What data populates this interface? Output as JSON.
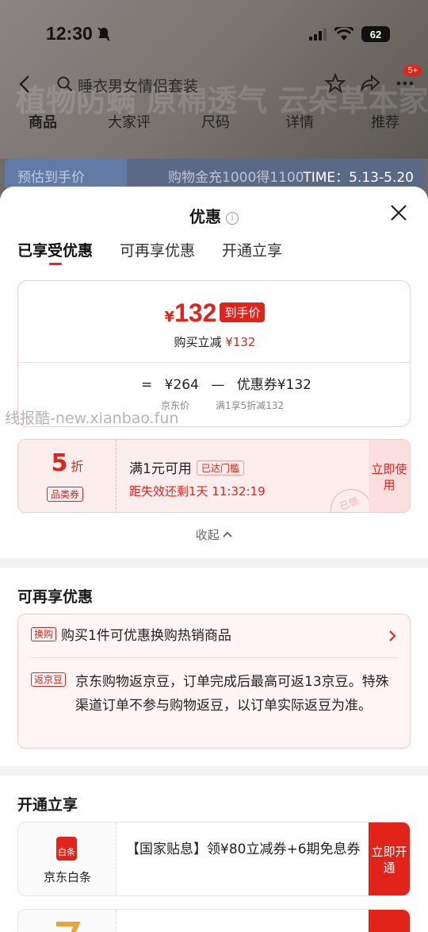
{
  "status": {
    "time": "12:30",
    "battery": "62"
  },
  "nav": {
    "search_text": "睡衣男女情侣套装",
    "cart_badge": "5+"
  },
  "bg_tabs": [
    "商品",
    "大家评",
    "尺码",
    "详情",
    "推荐"
  ],
  "bg_promo": {
    "left": "预估到手价",
    "middle": "购物金充1000得1100",
    "time": "TIME：5.13-5.20"
  },
  "bg_banner_text": "植物防螨 原棉透气 云朵草本家居服",
  "sheet": {
    "title": "优惠",
    "tabs": [
      "已享受优惠",
      "可再享优惠",
      "开通立享"
    ],
    "price": {
      "yen": "¥",
      "amount": "132",
      "tag": "到手价",
      "reduce_label": "购买立减",
      "reduce_value": "¥132"
    },
    "calc": {
      "eq": "=",
      "original": "¥264",
      "minus": "—",
      "coupon": "优惠券¥132",
      "original_sub": "京东价",
      "coupon_sub": "满1享5折减132"
    },
    "coupon": {
      "discount": "5",
      "unit": "折",
      "type": "品类券",
      "condition": "满1元可用",
      "reached": "已达门槛",
      "expire": "距失效还剩1天 11:32:19",
      "stamp": "已领",
      "action": "立即使用"
    },
    "collapse": "收起"
  },
  "watermark": "线报酷-new.xianbao.fun",
  "section_more": {
    "title": "可再享优惠",
    "rows": [
      {
        "tag": "换购",
        "text": "购买1件可优惠换购热销商品"
      },
      {
        "tag": "返京豆",
        "text": "京东购物返京豆，订单完成后最高可返13京豆。特殊渠道订单不参与购物返豆，以订单实际返豆为准。"
      }
    ]
  },
  "section_open": {
    "title": "开通立享",
    "card": {
      "icon_text": "白条",
      "name": "京东白条",
      "text": "【国家贴息】领¥80立减券+6期免息券",
      "action": "立即开通"
    }
  },
  "colors": {
    "accent": "#e2231a",
    "card_bg": "#fdeeee"
  }
}
